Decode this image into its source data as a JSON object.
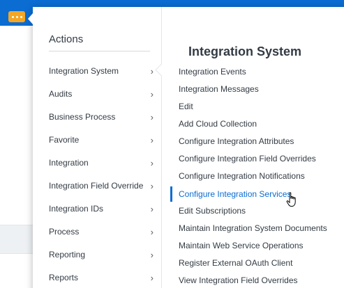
{
  "actions": {
    "title": "Actions",
    "items": [
      {
        "label": "Integration System"
      },
      {
        "label": "Audits"
      },
      {
        "label": "Business Process"
      },
      {
        "label": "Favorite"
      },
      {
        "label": "Integration"
      },
      {
        "label": "Integration Field Override"
      },
      {
        "label": "Integration IDs"
      },
      {
        "label": "Process"
      },
      {
        "label": "Reporting"
      },
      {
        "label": "Reports"
      }
    ]
  },
  "submenu": {
    "title": "Integration System",
    "items": [
      {
        "label": "Integration Events"
      },
      {
        "label": "Integration Messages"
      },
      {
        "label": "Edit"
      },
      {
        "label": "Add Cloud Collection"
      },
      {
        "label": "Configure Integration Attributes"
      },
      {
        "label": "Configure Integration Field Overrides"
      },
      {
        "label": "Configure Integration Notifications"
      },
      {
        "label": "Configure Integration Services"
      },
      {
        "label": "Edit Subscriptions"
      },
      {
        "label": "Maintain Integration System Documents"
      },
      {
        "label": "Maintain Web Service Operations"
      },
      {
        "label": "Register External OAuth Client"
      },
      {
        "label": "View Integration Field Overrides"
      }
    ]
  },
  "colors": {
    "accent": "#0b6cd2",
    "related_button": "#f5a623"
  }
}
